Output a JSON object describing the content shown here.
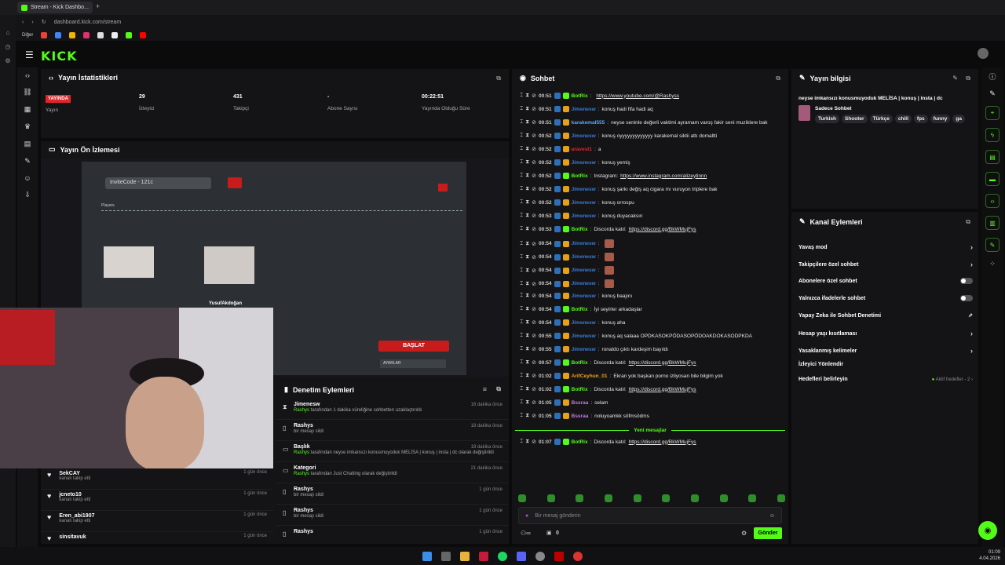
{
  "browser": {
    "tab_title": "Stream - Kick Dashbo...",
    "url": "dashboard.kick.com/stream",
    "bookmarks_label": "Diğer"
  },
  "brand": {
    "logo": "KICK"
  },
  "stats": {
    "title": "Yayın İstatistikleri",
    "live_badge": "YAYINDA",
    "live_label": "Yayın",
    "viewers_value": "29",
    "viewers_label": "İzleyici",
    "followers_value": "431",
    "followers_label": "Takipçi",
    "subs_value": "-",
    "subs_label": "Abone Sayısı",
    "uptime_value": "00:22:51",
    "uptime_label": "Yayında Olduğu Süre"
  },
  "preview": {
    "title": "Yayın Ön İzlemesi",
    "invite": "InviteCode - 121c",
    "players": "Players",
    "player_name": "YusufAkdoğan",
    "start_button": "BAŞLAT",
    "settings_button": "AYARLAR"
  },
  "followers_list": [
    {
      "name": "SekCAY",
      "sub": "kanalı takip etti",
      "time": "1 gün önce"
    },
    {
      "name": "jcneto10",
      "sub": "kanalı takip etti",
      "time": "1 gün önce"
    },
    {
      "name": "Eren_abi1907",
      "sub": "kanalı takip etti",
      "time": "1 gün önce"
    },
    {
      "name": "sinsitavuk",
      "sub": "",
      "time": "1 gün önce"
    }
  ],
  "moderation": {
    "title": "Denetim Eylemleri",
    "items": [
      {
        "name": "Jimenesw",
        "actor": "Rashys",
        "text": " tarafından 1 dakika süreliğine sohbetten uzaklaştırıldı",
        "time": "16 dakika önce"
      },
      {
        "name": "Rashys",
        "actor": "",
        "text": "bir mesajı sildi",
        "time": "18 dakika önce"
      },
      {
        "name": "Başlık",
        "actor": "Rashys",
        "text": " tarafından neyse imkansızı konusmuyoduk MELİSA | konuş | insta | dc olarak değiştirildi",
        "time": "19 dakika önce"
      },
      {
        "name": "Kategori",
        "actor": "Rashys",
        "text": " tarafından Just Chatting olarak değiştirildi",
        "time": "21 dakika önce"
      },
      {
        "name": "Rashys",
        "actor": "",
        "text": "bir mesajı sildi",
        "time": "1 gün önce"
      },
      {
        "name": "Rashys",
        "actor": "",
        "text": "bir mesajı sildi",
        "time": "1 gün önce"
      },
      {
        "name": "Rashys",
        "actor": "",
        "text": "",
        "time": "1 gün önce"
      }
    ]
  },
  "chat": {
    "title": "Sohbet",
    "messages": [
      {
        "time": "00:51",
        "user": "BotRix",
        "color": "#53fc18",
        "text": "",
        "link": "https://www.youtube.com/@Rashyss"
      },
      {
        "time": "00:51",
        "user": "Jimenesw",
        "color": "#3a7bd5",
        "text": "konuş hadi fifa hadi aq",
        "link": ""
      },
      {
        "time": "00:51",
        "user": "karakemal555",
        "color": "#5aa6ff",
        "text": "neyse seninle değerli vaktimi ayramam varoş fakir seni muziklere bak",
        "link": ""
      },
      {
        "time": "00:52",
        "user": "Jimenesw",
        "color": "#3a7bd5",
        "text": "konuş oyyyyyyyyyyyyy karakemal siktii attı domaltti",
        "link": ""
      },
      {
        "time": "00:52",
        "user": "aravest1",
        "color": "#e0262b",
        "text": "a",
        "link": ""
      },
      {
        "time": "00:52",
        "user": "Jimenesw",
        "color": "#3a7bd5",
        "text": "konuş yemiş",
        "link": ""
      },
      {
        "time": "00:52",
        "user": "BotRix",
        "color": "#53fc18",
        "text": "Instagram: ",
        "link": "https://www.instagram.com/alizeytinnn"
      },
      {
        "time": "00:52",
        "user": "Jimenesw",
        "color": "#3a7bd5",
        "text": "konuş şarkı değiş aq cigara mı vuruyon triplere bak",
        "link": ""
      },
      {
        "time": "00:52",
        "user": "Jimenesw",
        "color": "#3a7bd5",
        "text": "konuş orrospu",
        "link": ""
      },
      {
        "time": "00:53",
        "user": "Jimenesw",
        "color": "#3a7bd5",
        "text": "konuş duyacaksın",
        "link": ""
      },
      {
        "time": "00:53",
        "user": "BotRix",
        "color": "#53fc18",
        "text": "Discorda katıl: ",
        "link": "https://discord.gg/BkWMujFys"
      },
      {
        "time": "00:54",
        "user": "Jimenesw",
        "color": "#3a7bd5",
        "text": "",
        "link": ""
      },
      {
        "time": "00:54",
        "user": "Jimenesw",
        "color": "#3a7bd5",
        "text": "",
        "link": ""
      },
      {
        "time": "00:54",
        "user": "Jimenesw",
        "color": "#3a7bd5",
        "text": "",
        "link": ""
      },
      {
        "time": "00:54",
        "user": "Jimenesw",
        "color": "#3a7bd5",
        "text": "",
        "link": ""
      },
      {
        "time": "00:54",
        "user": "Jimenesw",
        "color": "#3a7bd5",
        "text": "konuş baajını",
        "link": ""
      },
      {
        "time": "00:54",
        "user": "BotRix",
        "color": "#53fc18",
        "text": "İyi seyirler arkadaşlar",
        "link": ""
      },
      {
        "time": "00:54",
        "user": "Jimenesw",
        "color": "#3a7bd5",
        "text": "konuş aha",
        "link": ""
      },
      {
        "time": "00:55",
        "user": "Jimenesw",
        "color": "#3a7bd5",
        "text": "konuş aq salaaa OPDKASOKPÖDASOPÖDOAKDOKASODPKDA",
        "link": ""
      },
      {
        "time": "00:55",
        "user": "Jimenesw",
        "color": "#3a7bd5",
        "text": "ronaldo çıktı kardeşim bayıldı",
        "link": ""
      },
      {
        "time": "00:57",
        "user": "BotRix",
        "color": "#53fc18",
        "text": "Discorda katıl: ",
        "link": "https://discord.gg/BkWMujFys"
      },
      {
        "time": "01:02",
        "user": "ArifCeyhun_01",
        "color": "#f0a020",
        "text": "Ekran yok başkan porno izliyosan bile bilgim yok",
        "link": ""
      },
      {
        "time": "01:02",
        "user": "BotRix",
        "color": "#53fc18",
        "text": "Discorda katıl: ",
        "link": "https://discord.gg/BkWMujFys"
      },
      {
        "time": "01:05",
        "user": "Bssraa",
        "color": "#c57bdc",
        "text": "selam",
        "link": ""
      },
      {
        "time": "01:05",
        "user": "Bssraa",
        "color": "#c57bdc",
        "text": "noluyoamkk söfmsödms",
        "link": ""
      }
    ],
    "new_messages_label": "Yeni mesajlar",
    "after": {
      "time": "01:07",
      "user": "BotRix",
      "color": "#53fc18",
      "text": "Discorda katıl: ",
      "link": "https://discord.gg/BkWMujFys"
    },
    "input_placeholder": "Bir mesaj gönderin",
    "counter": "0",
    "send_label": "Gönder"
  },
  "stream_info": {
    "title": "Yayın bilgisi",
    "stream_title": "neyse imkansızı konusmuyoduk MELİSA | konuş | insta | dc",
    "category": "Sadece Sohbet",
    "tags": [
      "Turkish",
      "Shooter",
      "Türkçe",
      "chill",
      "fps",
      "funny",
      "ga"
    ]
  },
  "channel_actions": {
    "title": "Kanal Eylemleri",
    "slow_mode": "Yavaş mod",
    "followers_only": "Takipçilere özel sohbet",
    "subs_only": "Abonelere özel sohbet",
    "emotes_only": "Yalnızca ifadelerle sohbet",
    "ai_moderation": "Yapay Zeka ile Sohbet Denetimi",
    "account_age": "Hesap yaşı kısıtlaması",
    "banned_words": "Yasaklanmış kelimeler",
    "redirect": "İzleyici Yönlendir",
    "goals": "Hedefleri belirleyin",
    "goals_status": "Aktif hedefler - 2"
  },
  "taskbar": {
    "time": "01:09",
    "date": "4.04.2026"
  },
  "accent": "#53fc18"
}
